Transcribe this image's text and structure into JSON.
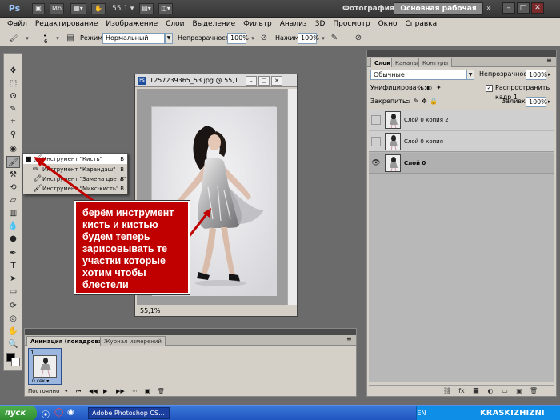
{
  "titlebar": {
    "app_logo": "Ps",
    "mb_label": "Mb",
    "zoom": "55,1",
    "workspace_photo": "Фотография",
    "workspace_main": "Основная рабочая среда",
    "workspace_more": "»",
    "win_min": "–",
    "win_max": "□",
    "win_close": "✕"
  },
  "menu": [
    "Файл",
    "Редактирование",
    "Изображение",
    "Слои",
    "Выделение",
    "Фильтр",
    "Анализ",
    "3D",
    "Просмотр",
    "Окно",
    "Справка"
  ],
  "options": {
    "brush_size": "6",
    "mode_label": "Режим:",
    "mode_value": "Нормальный",
    "opacity_label": "Непрозрачность:",
    "opacity_value": "100%",
    "pressure_label": "Нажим:",
    "pressure_value": "100%"
  },
  "flyout": [
    {
      "name": "Инструмент \"Кисть\"",
      "key": "B",
      "selected": true,
      "icon": "brush-icon"
    },
    {
      "name": "Инструмент \"Карандаш\"",
      "key": "B",
      "selected": false,
      "icon": "pencil-icon"
    },
    {
      "name": "Инструмент \"Замена цвета\"",
      "key": "B",
      "selected": false,
      "icon": "color-replace-icon"
    },
    {
      "name": "Инструмент \"Микс-кисть\"",
      "key": "B",
      "selected": false,
      "icon": "mixer-brush-icon"
    }
  ],
  "document": {
    "title": "1257239365_53.jpg @ 55,1...",
    "zoom_status": "55,1%"
  },
  "annotation": "берём инструмент кисть и кистью будем теперь зарисовывать те участки которые хотим чтобы блестели",
  "layers_panel": {
    "tabs": [
      "Слои",
      "Каналы",
      "Контуры"
    ],
    "blend_mode": "Обычные",
    "opacity_label": "Непрозрачность:",
    "opacity_value": "100%",
    "unify_label": "Унифицировать:",
    "propagate_label": "Распространить кадр 1",
    "lock_label": "Закрепить:",
    "fill_label": "Заливка:",
    "fill_value": "100%",
    "layers": [
      {
        "name": "Слой 0 копия 2",
        "visible": false,
        "selected": false
      },
      {
        "name": "Слой 0 копия",
        "visible": false,
        "selected": false
      },
      {
        "name": "Слой 0",
        "visible": true,
        "selected": true
      }
    ]
  },
  "animation_panel": {
    "tabs": [
      "Анимация (покадровая)",
      "Журнал измерений"
    ],
    "frame_number": "1",
    "frame_delay": "0 сек.▾",
    "loop": "Постоянно"
  },
  "taskbar": {
    "start": "пуск",
    "task_label": "Adobe Photoshop CS...",
    "lang": "EN",
    "watermark": "KRASKIZHIZNI"
  }
}
